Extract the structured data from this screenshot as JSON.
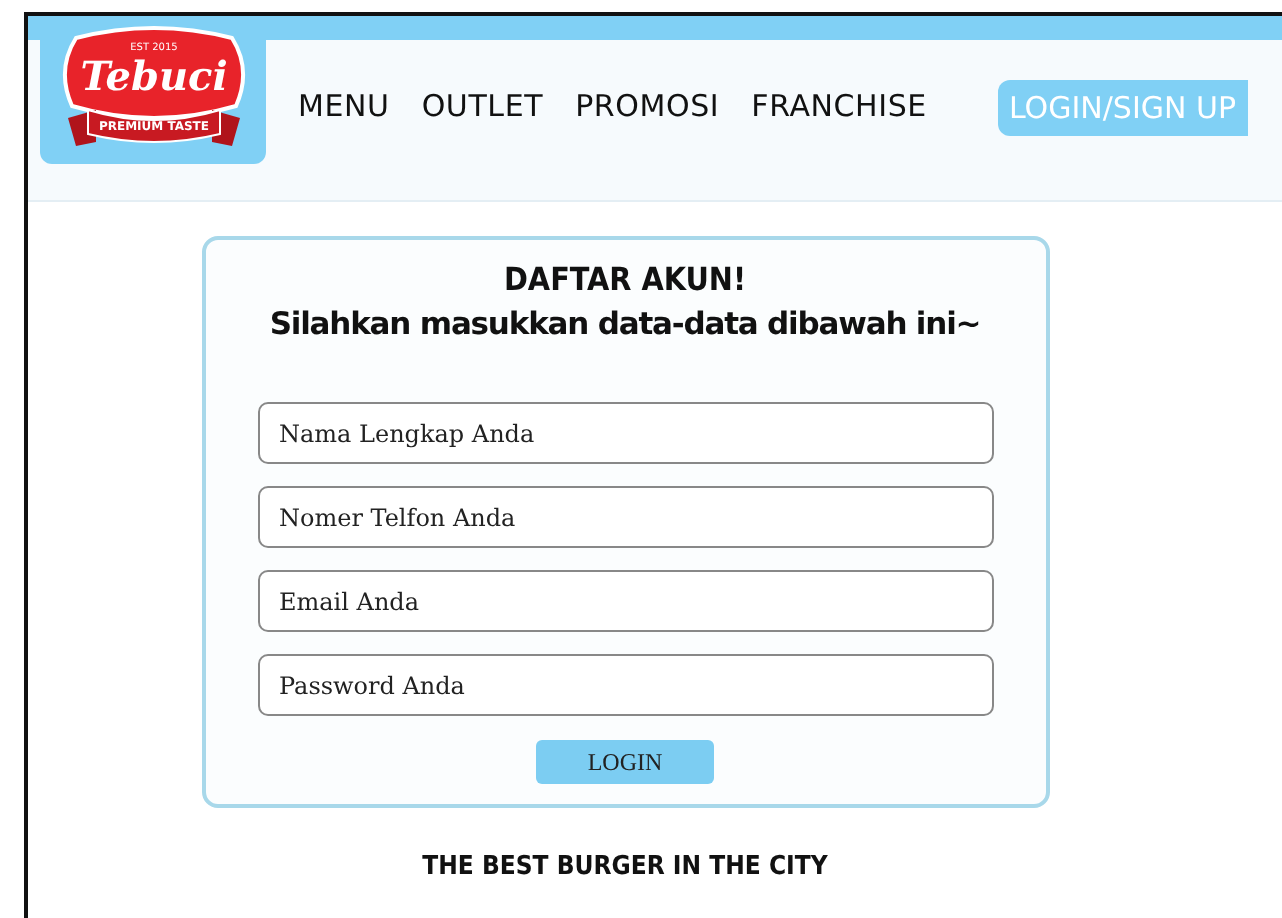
{
  "logo": {
    "established": "EST 2015",
    "brand": "Tebuci",
    "tagline": "PREMIUM TASTE"
  },
  "nav": [
    {
      "label": "MENU"
    },
    {
      "label": "OUTLET"
    },
    {
      "label": "PROMOSI"
    },
    {
      "label": "FRANCHISE"
    }
  ],
  "login_signup_button": "LOGIN/SIGN UP",
  "form": {
    "title": "DAFTAR AKUN!",
    "subtitle": "Silahkan masukkan data-data dibawah ini~",
    "fields": [
      {
        "placeholder": "Nama Lengkap Anda"
      },
      {
        "placeholder": "Nomer Telfon Anda"
      },
      {
        "placeholder": "Email Anda"
      },
      {
        "placeholder": "Password Anda"
      }
    ],
    "submit": "LOGIN"
  },
  "footer_tagline": "THE BEST BURGER IN THE CITY"
}
